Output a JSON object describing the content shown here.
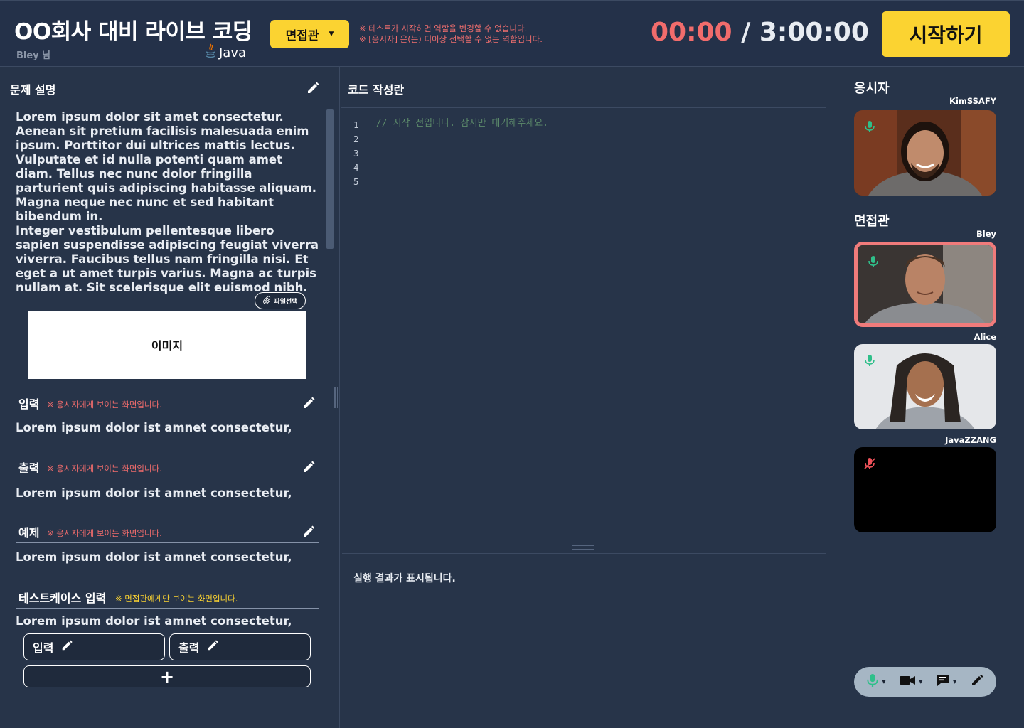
{
  "header": {
    "title": "OO회사 대비 라이브 코딩",
    "user_name": "Bley 님",
    "language": "Java",
    "role_label": "면접관",
    "warnings": [
      "※ 테스트가 시작하면 역할을 변경할 수 없습니다.",
      "※ [응시자] 은(는) 더이상 선택할 수 없는 역할입니다."
    ],
    "timer_elapsed": "00:00",
    "timer_separator": "/",
    "timer_total": "3:00:00",
    "start_label": "시작하기"
  },
  "problem": {
    "title": "문제 설명",
    "paragraphs": [
      "Lorem ipsum dolor sit amet consectetur. Aenean sit pretium facilisis malesuada enim ipsum. Porttitor dui ultrices mattis lectus. Vulputate et id nulla potenti quam amet diam. Tellus nec nunc dolor fringilla parturient quis adipiscing habitasse aliquam. Magna neque nec nunc et sed habitant bibendum in.",
      "Integer vestibulum pellentesque libero sapien suspendisse adipiscing feugiat viverra viverra. Faucibus tellus nam fringilla nisi. Et eget a ut amet turpis varius. Magna ac turpis nullam at. Sit scelerisque elit euismod nibh."
    ],
    "file_button_label": "파일선택",
    "image_label": "이미지",
    "sections": [
      {
        "title": "입력",
        "note": "※ 응시자에게 보이는 화면입니다.",
        "text": "Lorem ipsum dolor ist amnet consectetur,"
      },
      {
        "title": "출력",
        "note": "※ 응시자에게 보이는 화면입니다.",
        "text": "Lorem ipsum dolor ist amnet consectetur,"
      },
      {
        "title": "예제",
        "note": "※ 응시자에게 보이는 화면입니다.",
        "text": "Lorem ipsum dolor ist amnet consectetur,"
      },
      {
        "title": "테스트케이스 입력",
        "note": "※ 면접관에게만 보이는 화면입니다.",
        "text": "Lorem ipsum dolor ist amnet consectetur,"
      }
    ],
    "testcase_input_label": "입력",
    "testcase_output_label": "출력",
    "add_label": "+"
  },
  "code": {
    "title": "코드 작성란",
    "line_numbers": [
      "1",
      "2",
      "3",
      "4",
      "5"
    ],
    "placeholder_line": "// 시작 전입니다. 잠시만 대기해주세요.",
    "output_text": "실행 결과가 표시됩니다."
  },
  "participants": {
    "candidate_title": "응시자",
    "interviewer_title": "면접관",
    "candidate": {
      "name": "KimSSAFY",
      "mic": "on"
    },
    "interviewers": [
      {
        "name": "Bley",
        "mic": "on",
        "active": true
      },
      {
        "name": "Alice",
        "mic": "on",
        "active": false
      },
      {
        "name": "JavaZZANG",
        "mic": "off",
        "active": false
      }
    ]
  },
  "controls": [
    "mic-icon",
    "camera-icon",
    "chat-icon",
    "pencil-icon"
  ],
  "colors": {
    "background": "#273449",
    "accent_yellow": "#fbd331",
    "warning_red": "#f16c6c",
    "mic_green": "#2fbf8a",
    "active_border": "#f07b7b"
  }
}
